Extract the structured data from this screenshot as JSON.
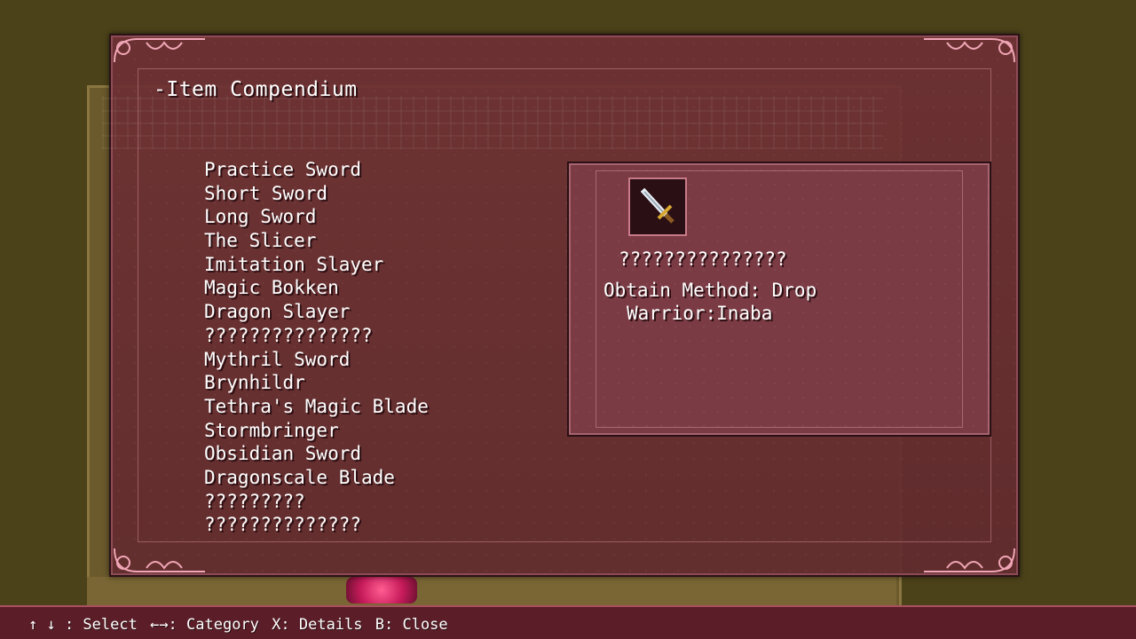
{
  "window": {
    "title": "-Item Compendium"
  },
  "items": [
    "Practice Sword",
    "Short Sword",
    "Long Sword",
    "The Slicer",
    "Imitation Slayer",
    "Magic Bokken",
    "Dragon Slayer",
    "???????????????",
    "Mythril Sword",
    "Brynhildr",
    "Tethra's Magic Blade",
    "Stormbringer",
    "Obsidian Sword",
    "Dragonscale Blade",
    "?????????",
    "??????????????"
  ],
  "selected_index": 7,
  "detail": {
    "icon": "sword-icon",
    "name": "???????????????",
    "obtain": "Obtain Method: Drop",
    "source": "Warrior:Inaba"
  },
  "help": {
    "select": "↑ ↓ : Select",
    "category": "←→: Category",
    "details": "X: Details",
    "close": "B: Close"
  },
  "colors": {
    "accent": "#e8287a",
    "panel": "#6e3034"
  }
}
